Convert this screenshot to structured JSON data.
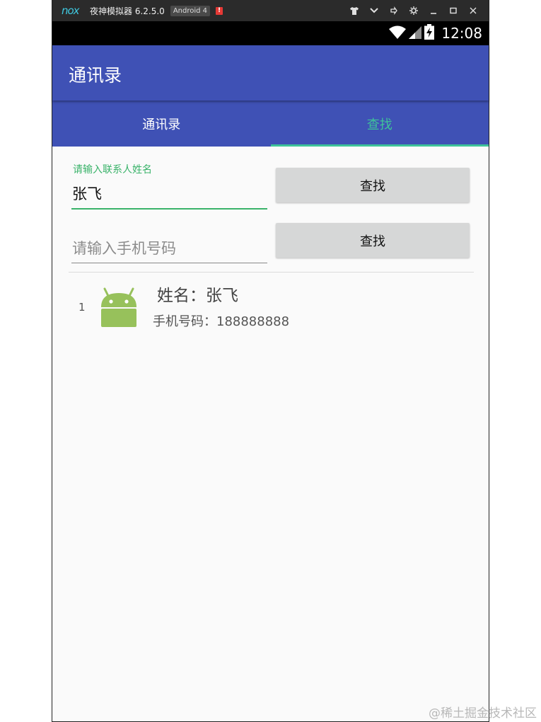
{
  "emulator": {
    "logo_text": "nox",
    "name": "夜神模拟器 6.2.5.0",
    "android_badge": "Android 4",
    "alert": "!",
    "controls": [
      "shirt-icon",
      "chevron-down-icon",
      "pin-icon",
      "gear-icon",
      "minimize-icon",
      "maximize-icon",
      "close-icon"
    ]
  },
  "status_bar": {
    "time": "12:08",
    "icons": [
      "wifi-icon",
      "signal-icon",
      "battery-charging-icon"
    ]
  },
  "app_bar": {
    "title": "通讯录"
  },
  "tabs": [
    {
      "label": "通讯录",
      "selected": false
    },
    {
      "label": "查找",
      "selected": true
    }
  ],
  "form": {
    "name_field": {
      "floating_label": "请输入联系人姓名",
      "value": "张飞"
    },
    "phone_field": {
      "placeholder": "请输入手机号码",
      "value": ""
    },
    "search_button_1": "查找",
    "search_button_2": "查找"
  },
  "results": [
    {
      "index": "1",
      "name": "姓名：张飞",
      "phone": "手机号码：188888888",
      "icon": "android-icon"
    }
  ],
  "watermark": "@稀土掘金技术社区",
  "colors": {
    "primary": "#3f51b5",
    "accent": "#3ec399",
    "input_focus": "#3ab36a",
    "android_green": "#97c15b"
  }
}
